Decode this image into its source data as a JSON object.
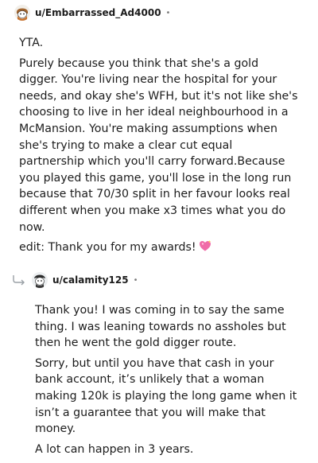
{
  "comment1": {
    "username": "u/Embarrassed_Ad4000",
    "separator": "•",
    "paragraphs": [
      "YTA.",
      "Purely because you think that she's a gold digger. You're living near the hospital for your needs, and okay she's WFH, but it's not like she's choosing to live in her ideal neighbourhood in a McMansion. You're making assumptions when she's trying to make a clear cut equal partnership which you'll carry forward.Because you played this game, you'll lose in the long run because that 70/30 split in her favour looks real different when you make x3 times what you do now."
    ],
    "edit_text": "edit: Thank you for my awards!",
    "edit_emoji_icon": "sparkling-heart-icon"
  },
  "comment2": {
    "username": "u/calamity125",
    "separator": "•",
    "paragraphs": [
      "Thank you! I was coming in to say the same thing. I was leaning towards no assholes but then he went the gold digger route.",
      "Sorry, but until you have that cash in your bank account, it’s unlikely that a woman making 120k is playing the long game when it isn’t a guarantee that you will make that money.",
      "A lot can happen in 3 years."
    ]
  },
  "colors": {
    "text": "#1c1c1c",
    "meta": "#7c7c7c",
    "heart": "#f06ba8"
  }
}
